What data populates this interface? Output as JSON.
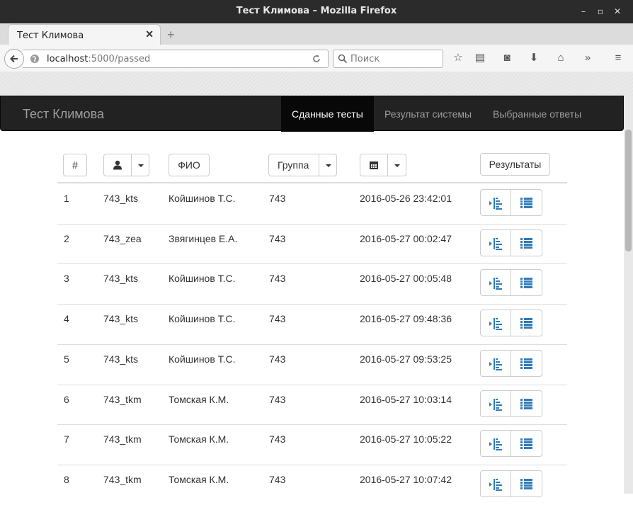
{
  "window": {
    "title": "Тест Климова – Mozilla Firefox"
  },
  "browser": {
    "tab_title": "Тест Климова",
    "url_host": "localhost",
    "url_path": ":5000/passed",
    "search_placeholder": "Поиск"
  },
  "app": {
    "brand": "Тест Климова",
    "nav": [
      {
        "label": "Сданные тесты",
        "active": true
      },
      {
        "label": "Результат системы",
        "active": false
      },
      {
        "label": "Выбранные ответы",
        "active": false
      }
    ]
  },
  "table": {
    "headers": {
      "num": "#",
      "fio": "ФИО",
      "group": "Группа",
      "results": "Результаты"
    },
    "rows": [
      {
        "n": "1",
        "login": "743_kts",
        "fio": "Койшинов Т.С.",
        "group": "743",
        "date": "2016-05-26 23:42:01"
      },
      {
        "n": "2",
        "login": "743_zea",
        "fio": "Звягинцев Е.А.",
        "group": "743",
        "date": "2016-05-27 00:02:47"
      },
      {
        "n": "3",
        "login": "743_kts",
        "fio": "Койшинов Т.С.",
        "group": "743",
        "date": "2016-05-27 00:05:48"
      },
      {
        "n": "4",
        "login": "743_kts",
        "fio": "Койшинов Т.С.",
        "group": "743",
        "date": "2016-05-27 09:48:36"
      },
      {
        "n": "5",
        "login": "743_kts",
        "fio": "Койшинов Т.С.",
        "group": "743",
        "date": "2016-05-27 09:53:25"
      },
      {
        "n": "6",
        "login": "743_tkm",
        "fio": "Томская К.М.",
        "group": "743",
        "date": "2016-05-27 10:03:14"
      },
      {
        "n": "7",
        "login": "743_tkm",
        "fio": "Томская К.М.",
        "group": "743",
        "date": "2016-05-27 10:05:22"
      },
      {
        "n": "8",
        "login": "743_tkm",
        "fio": "Томская К.М.",
        "group": "743",
        "date": "2016-05-27 10:07:42"
      }
    ]
  },
  "colors": {
    "icon_blue": "#337ab7",
    "navbar": "#222222"
  }
}
